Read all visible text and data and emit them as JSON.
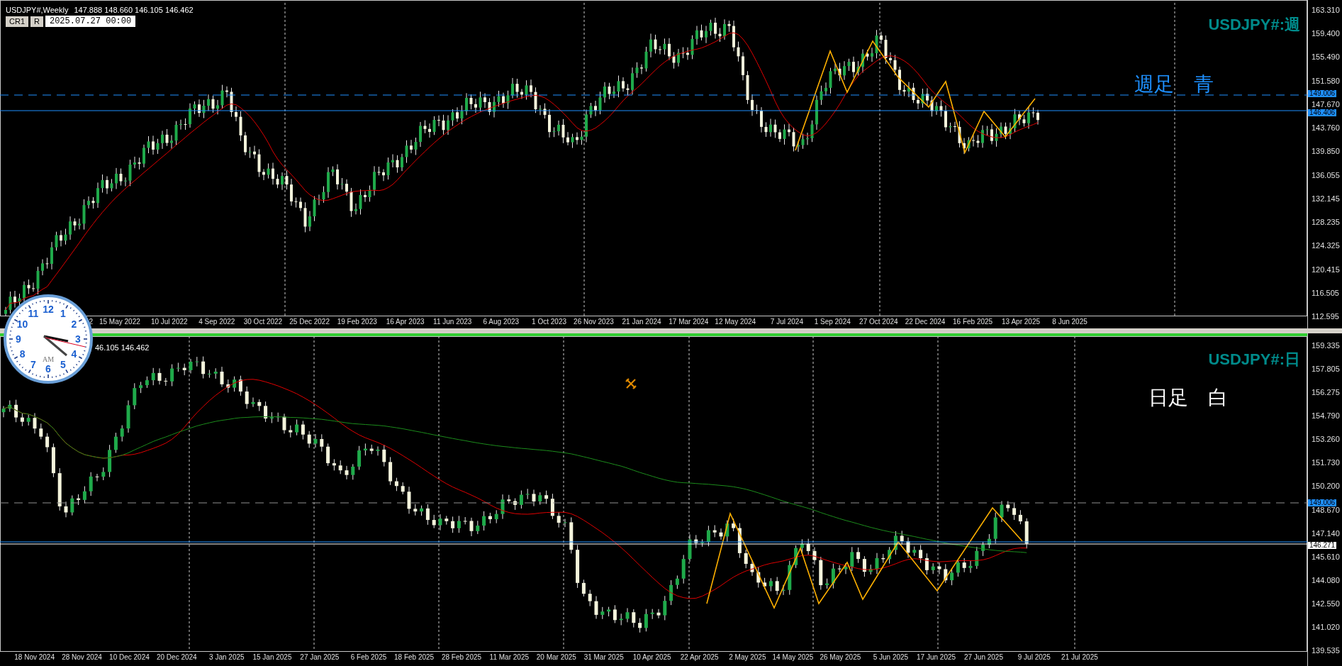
{
  "panes": [
    {
      "header": {
        "symbol": "USDJPY#,Weekly",
        "ohlc": "147.888 148.660 146.105 146.462"
      },
      "buttons": [
        "CR1",
        "R"
      ],
      "date_field": "2025.07.27 00:00",
      "title": "USDJPY#:週",
      "note": "週足　青",
      "price_axis": [
        "163.310",
        "159.400",
        "155.490",
        "151.580",
        "147.670",
        "143.760",
        "139.850",
        "136.055",
        "132.145",
        "128.235",
        "124.325",
        "120.415",
        "116.505",
        "112.595"
      ],
      "price_markers": [
        {
          "text": "149.006",
          "color": "#1e90ff"
        },
        {
          "text": "146.406",
          "color": "#1e90ff"
        }
      ],
      "time_axis": [
        "2",
        "15 May 2022",
        "10 Jul 2022",
        "4 Sep 2022",
        "30 Oct 2022",
        "25 Dec 2022",
        "19 Feb 2023",
        "16 Apr 2023",
        "11 Jun 2023",
        "6 Aug 2023",
        "1 Oct 2023",
        "26 Nov 2023",
        "21 Jan 2024",
        "17 Mar 2024",
        "12 May 2024",
        "7 Jul 2024",
        "1 Sep 2024",
        "27 Oct 2024",
        "22 Dec 2024",
        "16 Feb 2025",
        "13 Apr 2025",
        "8 Jun 2025"
      ]
    },
    {
      "header": {
        "ohlc": "46.105 146.462"
      },
      "title": "USDJPY#:日",
      "note": "日足　白",
      "price_axis": [
        "159.335",
        "157.805",
        "156.275",
        "154.790",
        "153.260",
        "151.730",
        "150.200",
        "148.670",
        "147.140",
        "145.610",
        "144.080",
        "142.550",
        "141.020",
        "139.535"
      ],
      "price_markers": [
        {
          "text": "149.006",
          "color": "#1e90ff"
        },
        {
          "text": "146.271",
          "color": "#ffffff"
        }
      ],
      "time_axis": [
        "18 Nov 2024",
        "28 Nov 2024",
        "10 Dec 2024",
        "20 Dec 2024",
        "3 Jan 2025",
        "15 Jan 2025",
        "27 Jan 2025",
        "6 Feb 2025",
        "18 Feb 2025",
        "28 Feb 2025",
        "11 Mar 2025",
        "20 Mar 2025",
        "31 Mar 2025",
        "10 Apr 2025",
        "22 Apr 2025",
        "2 May 2025",
        "14 May 2025",
        "26 May 2025",
        "5 Jun 2025",
        "17 Jun 2025",
        "27 Jun 2025",
        "9 Jul 2025",
        "21 Jul 2025"
      ]
    }
  ],
  "clock": {
    "numerals": [
      "12",
      "11",
      "1",
      "10",
      "2",
      "9",
      "3",
      "8",
      "4",
      "7",
      "5",
      "6"
    ],
    "period": "AM"
  }
}
